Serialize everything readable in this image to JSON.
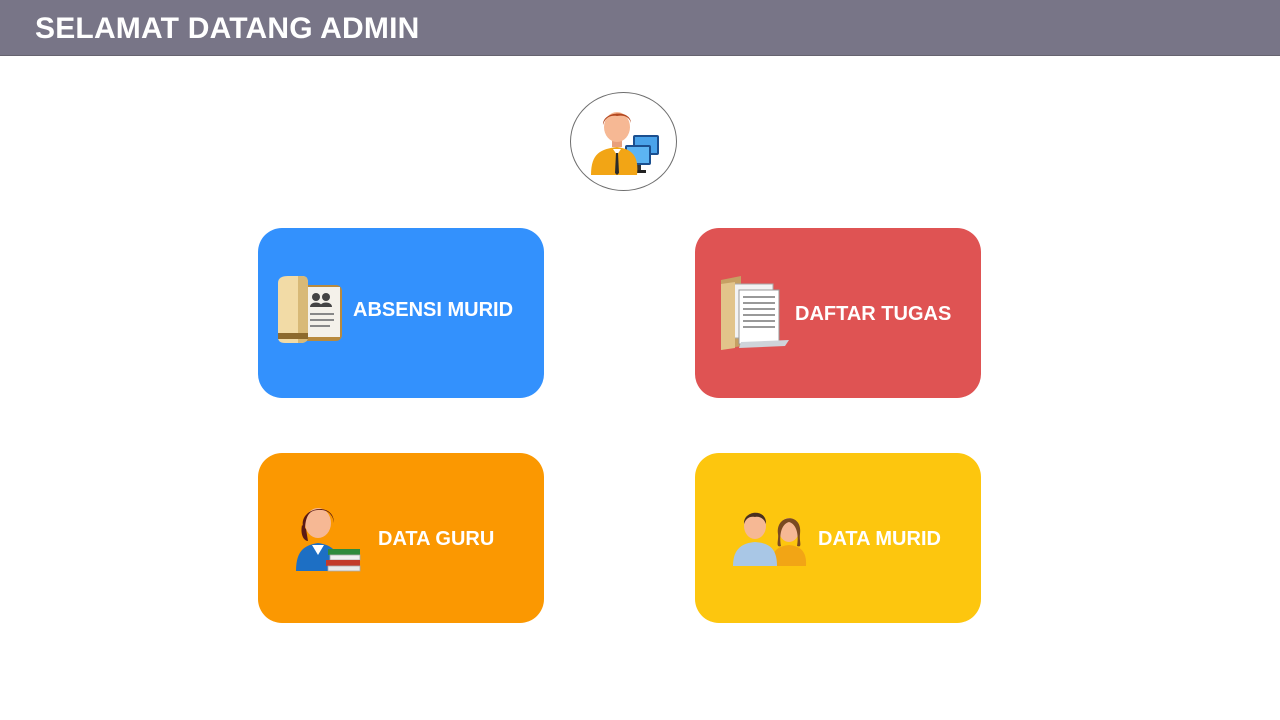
{
  "header": {
    "title": "SELAMAT DATANG ADMIN"
  },
  "avatar": {
    "icon": "admin-user-computer-icon"
  },
  "menu": {
    "absensi": {
      "label": "ABSENSI MURID",
      "color": "#3391fd",
      "icon": "attendance-folder-icon"
    },
    "tugas": {
      "label": "DAFTAR TUGAS",
      "color": "#df5353",
      "icon": "documents-folder-icon"
    },
    "guru": {
      "label": "DATA GURU",
      "color": "#fb9801",
      "icon": "teacher-books-icon"
    },
    "murid": {
      "label": "DATA MURID",
      "color": "#fdc60e",
      "icon": "students-group-icon"
    }
  }
}
